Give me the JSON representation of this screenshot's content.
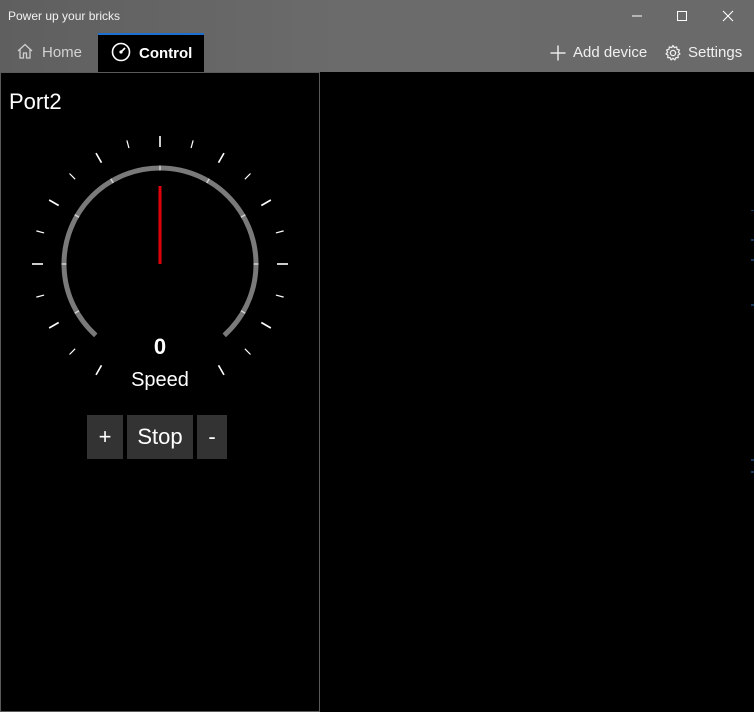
{
  "window": {
    "title": "Power up your bricks"
  },
  "nav": {
    "tabs": [
      {
        "label": "Home",
        "icon": "home-icon",
        "active": false
      },
      {
        "label": "Control",
        "icon": "gauge-icon",
        "active": true
      }
    ],
    "actions": [
      {
        "label": "Add device",
        "icon": "plus-icon"
      },
      {
        "label": "Settings",
        "icon": "gear-icon"
      }
    ]
  },
  "control": {
    "port_name": "Port2",
    "speed_value": "0",
    "speed_label": "Speed",
    "buttons": {
      "plus": "+",
      "stop": "Stop",
      "minus": "-"
    }
  },
  "colors": {
    "accent": "#1f6fd1",
    "needle": "#e0000b",
    "gauge_arc": "#7a7a7a",
    "button_bg": "#333333"
  },
  "gauge": {
    "min": -100,
    "max": 100,
    "value": 0
  }
}
